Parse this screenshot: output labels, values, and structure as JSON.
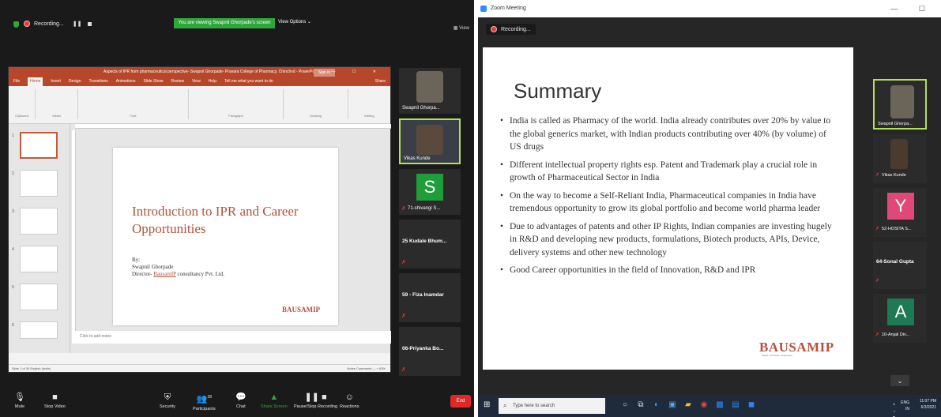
{
  "left_window": {
    "recording_label": "Recording...",
    "viewing_banner": "You are viewing Swapnil Ghorpade's screen",
    "view_options": "View Options ⌄",
    "view_button": "View",
    "ppt": {
      "window_title": "Aspects of IPR from pharmaceutical perspective- Swapnil Ghorpade- Pravara College of Pharmacy, Chinchvd - PowerPoint",
      "sign_in": "Sign in",
      "menu_tabs": [
        "File",
        "Home",
        "Insert",
        "Design",
        "Transitions",
        "Animations",
        "Slide Show",
        "Review",
        "View",
        "Help",
        "Tell me what you want to do",
        "Share"
      ],
      "ribbon_groups": [
        "Clipboard",
        "Slides",
        "Font",
        "Paragraph",
        "Drawing",
        "Editing"
      ],
      "slide_title": "Introduction to IPR and Career Opportunities",
      "slide_by": "By:",
      "slide_name": "Swapnil Ghorpade",
      "slide_director": "Director-",
      "slide_company_link": "BausamIP",
      "slide_company_rest": " consultancy Pvt. Ltd.",
      "slide_logo": "BAUSAM",
      "slide_logo_ip": "IP",
      "notes_placeholder": "Click to add notes",
      "status_text": "Slide 1 of 30  English (India)",
      "status_right": "Notes  Comments  — + 63%",
      "thumb_numbers": [
        "1",
        "2",
        "3",
        "4",
        "5",
        "6"
      ]
    },
    "participants": [
      {
        "name": "Swapnil Ghorpa..."
      },
      {
        "name": "Vikas Kunde"
      },
      {
        "name": "71-shivangi S...",
        "initial": "S"
      },
      {
        "name": "25 Kudale Bhum..."
      },
      {
        "name": "59 - Fiza Inamdar"
      },
      {
        "name": "06-Priyanka Bo..."
      }
    ],
    "toolbar": {
      "mute": "Mute",
      "stop_video": "Stop Video",
      "security": "Security",
      "participants": "Participants",
      "participants_count": "28",
      "chat": "Chat",
      "share_screen": "Share Screen",
      "pause_stop": "Pause/Stop Recording",
      "reactions": "Reactions",
      "end": "End"
    }
  },
  "right_window": {
    "title": "Zoom Meeting",
    "recording_label": "Recording...",
    "slide": {
      "title": "Summary",
      "bullets": [
        "India is called as Pharmacy of the world.  India already contributes over 20% by value to the global generics market, with Indian products contributing over 40% (by volume) of US drugs",
        "Different intellectual property rights esp. Patent and Trademark play a crucial role in growth of Pharmaceutical Sector in India",
        "On the way to become a Self-Reliant India, Pharmaceutical companies in India have tremendous opportunity to grow its global portfolio and become world pharma leader",
        "Due to advantages of patents and other IP Rights, Indian companies are investing hugely in R&D and developing new products, formulations, Biotech products, APIs, Device, delivery systems and other new technology",
        "Good Career opportunities in the field of Innovation, R&D and IPR"
      ],
      "logo": "BAUSAM",
      "logo_ip": "IP",
      "logo_tagline": "Ideate | Innovate | Implement"
    },
    "participants": [
      {
        "name": "Swapnil Ghorpa..."
      },
      {
        "name": "Vikas Kunde"
      },
      {
        "name": "52-HOSITA S...",
        "initial": "Y"
      },
      {
        "name": "64-Sonal Gupta"
      },
      {
        "name": "10-Anjali Div...",
        "initial": "A"
      }
    ],
    "taskbar": {
      "search_placeholder": "Type here to search",
      "lang": "ENG",
      "region": "IN",
      "time": "11:07 PM",
      "date": "6/3/2021"
    }
  },
  "colors": {
    "ppt_accent": "#b7472a",
    "slide_title": "#b5523b",
    "zoom_bg": "#1a1a1a",
    "banner_green": "#2ea83c",
    "end_red": "#e02828"
  }
}
